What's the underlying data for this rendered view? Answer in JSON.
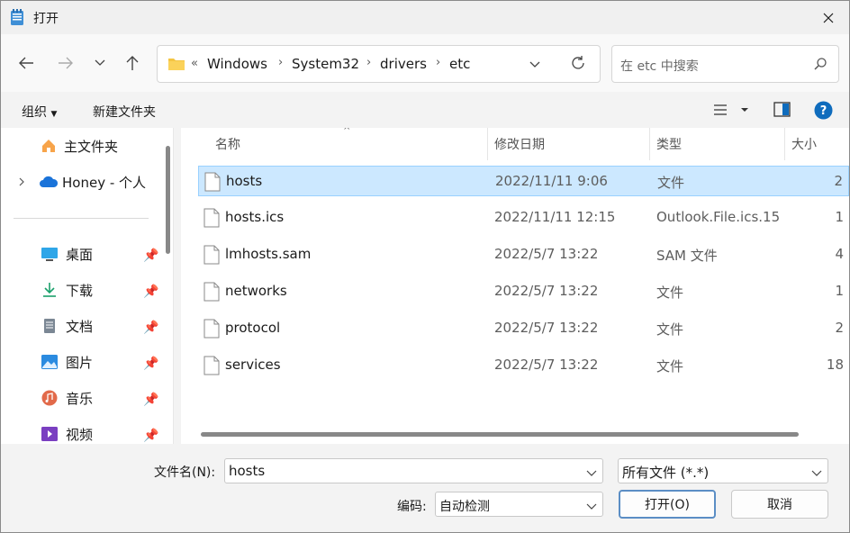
{
  "window": {
    "title": "打开"
  },
  "nav": {
    "breadcrumb_overflow": "«",
    "breadcrumbs": [
      "Windows",
      "System32",
      "drivers",
      "etc"
    ],
    "search_placeholder": "在 etc 中搜索"
  },
  "toolbar": {
    "organize": "组织",
    "new_folder": "新建文件夹"
  },
  "sidebar": {
    "home": "主文件夹",
    "cloud": "Honey - 个人",
    "items": [
      {
        "label": "桌面",
        "icon": "desktop-icon"
      },
      {
        "label": "下载",
        "icon": "download-icon"
      },
      {
        "label": "文档",
        "icon": "documents-icon"
      },
      {
        "label": "图片",
        "icon": "pictures-icon"
      },
      {
        "label": "音乐",
        "icon": "music-icon"
      },
      {
        "label": "视频",
        "icon": "videos-icon"
      }
    ]
  },
  "columns": {
    "name": "名称",
    "modified": "修改日期",
    "type": "类型",
    "size": "大小"
  },
  "files": [
    {
      "name": "hosts",
      "modified": "2022/11/11 9:06",
      "type": "文件",
      "size": "2"
    },
    {
      "name": "hosts.ics",
      "modified": "2022/11/11 12:15",
      "type": "Outlook.File.ics.15",
      "size": "1"
    },
    {
      "name": "lmhosts.sam",
      "modified": "2022/5/7 13:22",
      "type": "SAM 文件",
      "size": "4"
    },
    {
      "name": "networks",
      "modified": "2022/5/7 13:22",
      "type": "文件",
      "size": "1"
    },
    {
      "name": "protocol",
      "modified": "2022/5/7 13:22",
      "type": "文件",
      "size": "2"
    },
    {
      "name": "services",
      "modified": "2022/5/7 13:22",
      "type": "文件",
      "size": "18"
    }
  ],
  "footer": {
    "filename_label": "文件名(N):",
    "filename_value": "hosts",
    "filter_value": "所有文件  (*.*)",
    "encoding_label": "编码:",
    "encoding_value": "自动检测",
    "open_button": "打开(O)",
    "cancel_button": "取消"
  },
  "colors": {
    "selection": "#cce8ff",
    "selection_border": "#99d1ff",
    "accent": "#0f6cbd",
    "folder": "#f4c542"
  }
}
